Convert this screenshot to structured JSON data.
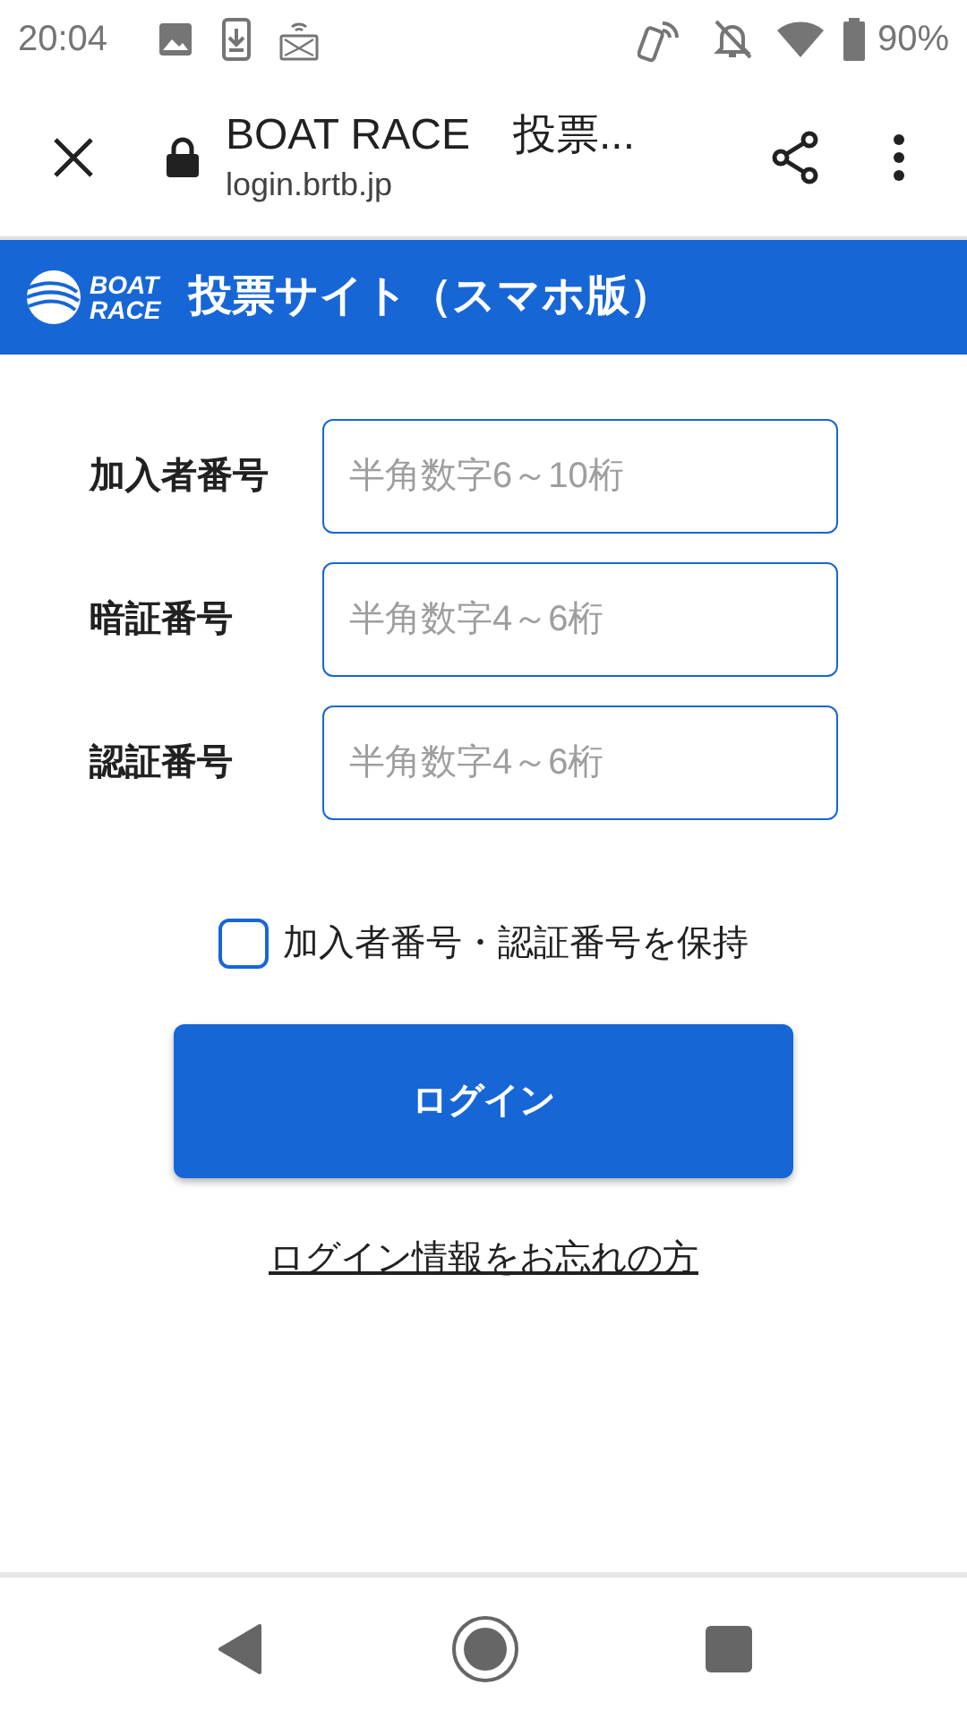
{
  "status_bar": {
    "time": "20:04",
    "battery": "90%"
  },
  "browser": {
    "title": "BOAT RACE　投票...",
    "url": "login.brtb.jp"
  },
  "header": {
    "logo_top": "BOAT",
    "logo_bottom": "RACE",
    "title": "投票サイト（スマホ版）"
  },
  "fields": [
    {
      "label": "加入者番号",
      "placeholder": "半角数字6～10桁"
    },
    {
      "label": "暗証番号",
      "placeholder": "半角数字4～6桁"
    },
    {
      "label": "認証番号",
      "placeholder": "半角数字4～6桁"
    }
  ],
  "remember": {
    "label": "加入者番号・認証番号を保持",
    "checked": false
  },
  "login_button": "ログイン",
  "forgot_link": "ログイン情報をお忘れの方"
}
